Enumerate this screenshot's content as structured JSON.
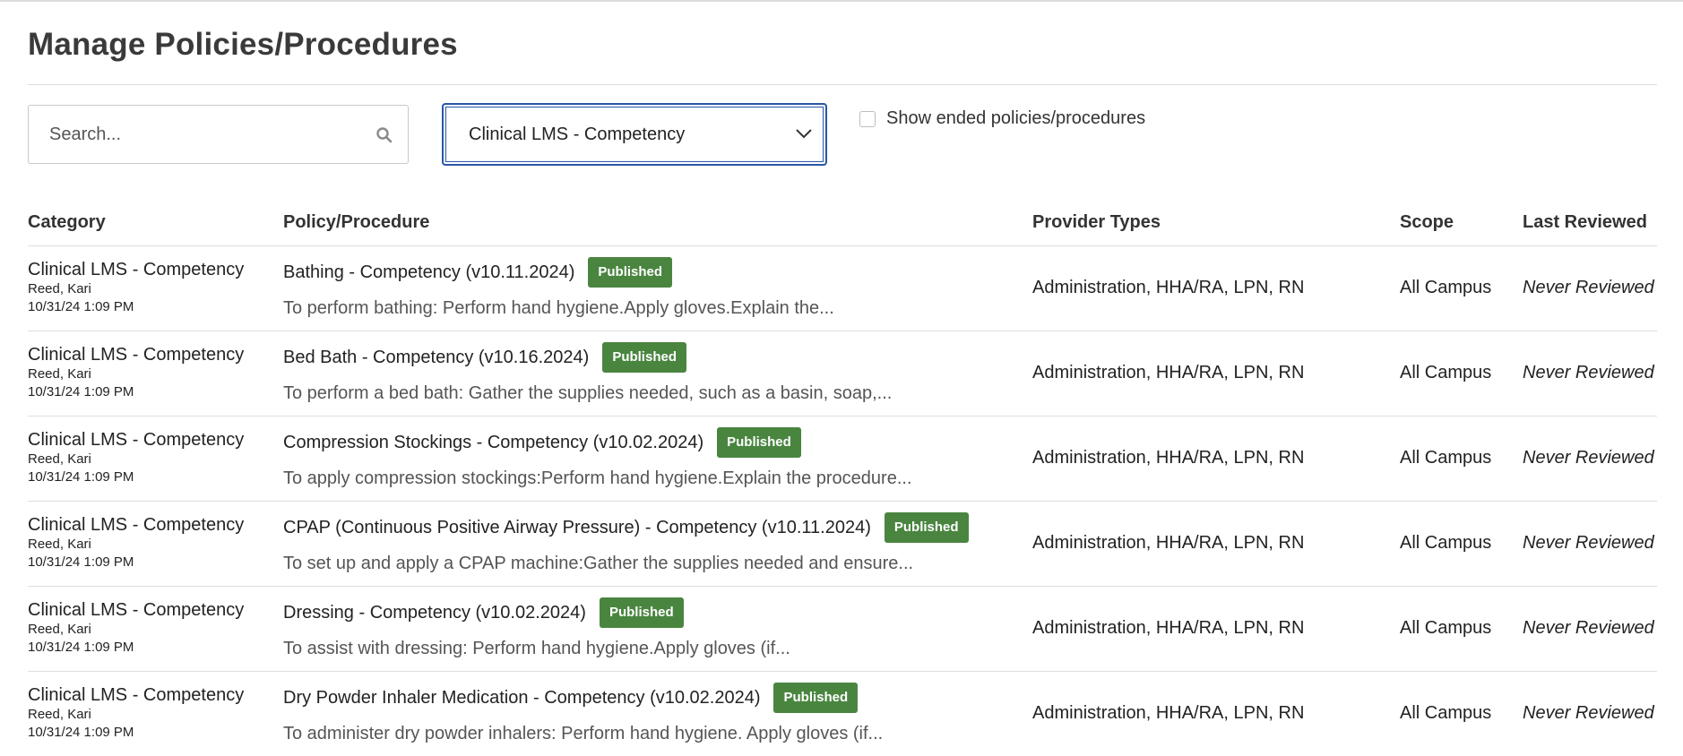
{
  "page": {
    "title": "Manage Policies/Procedures"
  },
  "filters": {
    "search_placeholder": "Search...",
    "search_icon": "search-icon",
    "category_select_value": "Clinical LMS - Competency",
    "show_ended_label": "Show ended policies/procedures",
    "show_ended_checked": false
  },
  "colors": {
    "badge_published": "#4a8540",
    "select_focus_border": "#2a57a6"
  },
  "table": {
    "headers": {
      "category": "Category",
      "policy": "Policy/Procedure",
      "provider_types": "Provider Types",
      "scope": "Scope",
      "last_reviewed": "Last Reviewed"
    },
    "rows": [
      {
        "category": "Clinical LMS - Competency",
        "author": "Reed, Kari",
        "date": "10/31/24 1:09 PM",
        "title": "Bathing - Competency (v10.11.2024)",
        "status": "Published",
        "description": "To perform bathing: Perform hand hygiene.Apply gloves.Explain the...",
        "provider_types": "Administration, HHA/RA, LPN, RN",
        "scope": "All Campus",
        "last_reviewed": "Never Reviewed"
      },
      {
        "category": "Clinical LMS - Competency",
        "author": "Reed, Kari",
        "date": "10/31/24 1:09 PM",
        "title": "Bed Bath - Competency (v10.16.2024)",
        "status": "Published",
        "description": "To perform a bed bath: Gather the supplies needed, such as a basin, soap,...",
        "provider_types": "Administration, HHA/RA, LPN, RN",
        "scope": "All Campus",
        "last_reviewed": "Never Reviewed"
      },
      {
        "category": "Clinical LMS - Competency",
        "author": "Reed, Kari",
        "date": "10/31/24 1:09 PM",
        "title": "Compression Stockings - Competency (v10.02.2024)",
        "status": "Published",
        "description": "To apply compression stockings:Perform hand hygiene.Explain the procedure...",
        "provider_types": "Administration, HHA/RA, LPN, RN",
        "scope": "All Campus",
        "last_reviewed": "Never Reviewed"
      },
      {
        "category": "Clinical LMS - Competency",
        "author": "Reed, Kari",
        "date": "10/31/24 1:09 PM",
        "title": "CPAP (Continuous Positive Airway Pressure) - Competency (v10.11.2024)",
        "status": "Published",
        "description": "To set up and apply a CPAP machine:Gather the supplies needed and ensure...",
        "provider_types": "Administration, HHA/RA, LPN, RN",
        "scope": "All Campus",
        "last_reviewed": "Never Reviewed"
      },
      {
        "category": "Clinical LMS - Competency",
        "author": "Reed, Kari",
        "date": "10/31/24 1:09 PM",
        "title": "Dressing - Competency (v10.02.2024)",
        "status": "Published",
        "description": "To assist with dressing: Perform hand hygiene.Apply gloves (if...",
        "provider_types": "Administration, HHA/RA, LPN, RN",
        "scope": "All Campus",
        "last_reviewed": "Never Reviewed"
      },
      {
        "category": "Clinical LMS - Competency",
        "author": "Reed, Kari",
        "date": "10/31/24 1:09 PM",
        "title": "Dry Powder Inhaler Medication - Competency (v10.02.2024)",
        "status": "Published",
        "description": "To administer dry powder inhalers: Perform hand hygiene. Apply gloves (if...",
        "provider_types": "Administration, HHA/RA, LPN, RN",
        "scope": "All Campus",
        "last_reviewed": "Never Reviewed"
      }
    ]
  }
}
